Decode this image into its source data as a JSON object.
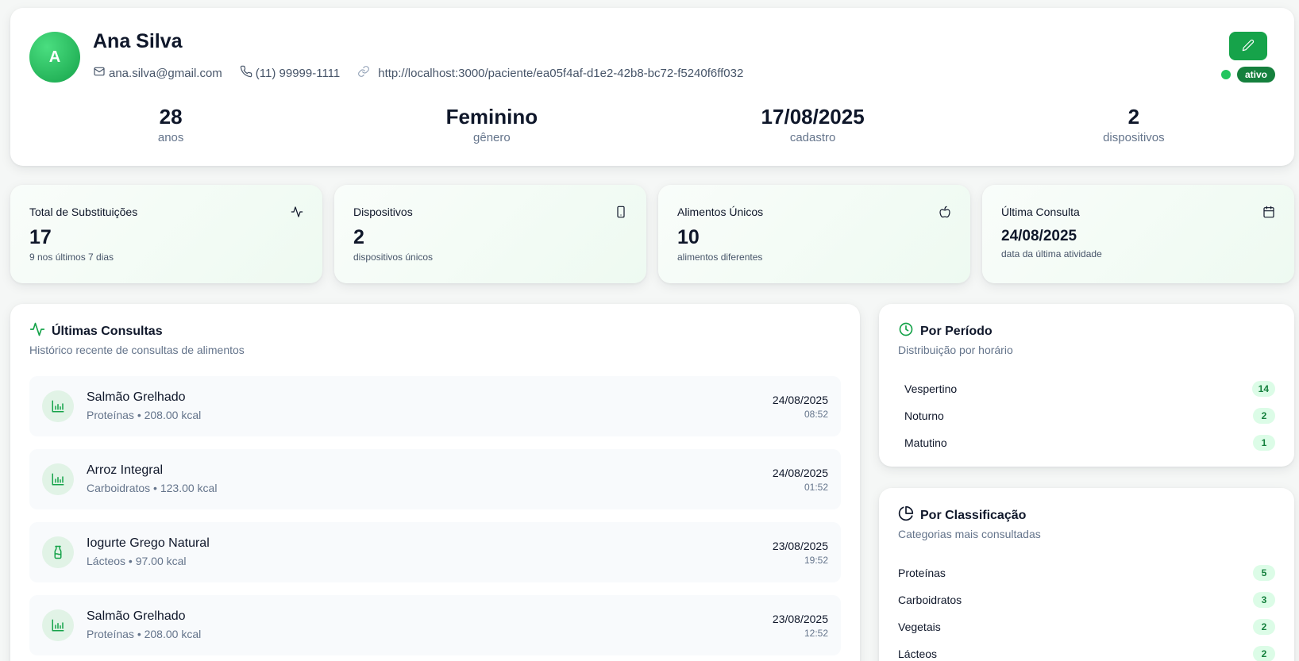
{
  "profile": {
    "avatar_initial": "A",
    "name": "Ana Silva",
    "email": "ana.silva@gmail.com",
    "phone": "(11) 99999-1111",
    "link": "http://localhost:3000/paciente/ea05f4af-d1e2-42b8-bc72-f5240f6ff032",
    "status": "ativo",
    "stats": [
      {
        "value": "28",
        "label": "anos"
      },
      {
        "value": "Feminino",
        "label": "gênero"
      },
      {
        "value": "17/08/2025",
        "label": "cadastro"
      },
      {
        "value": "2",
        "label": "dispositivos"
      }
    ]
  },
  "metrics": [
    {
      "title": "Total de Substituições",
      "icon": "activity-icon",
      "value": "17",
      "sub": "9 nos últimos 7 dias"
    },
    {
      "title": "Dispositivos",
      "icon": "smartphone-icon",
      "value": "2",
      "sub": "dispositivos únicos"
    },
    {
      "title": "Alimentos Únicos",
      "icon": "apple-icon",
      "value": "10",
      "sub": "alimentos diferentes"
    },
    {
      "title": "Última Consulta",
      "icon": "calendar-icon",
      "value": "24/08/2025",
      "sub": "data da última atividade"
    }
  ],
  "consultas": {
    "title": "Últimas Consultas",
    "subtitle": "Histórico recente de consultas de alimentos",
    "items": [
      {
        "name": "Salmão Grelhado",
        "detail": "Proteínas • 208.00 kcal",
        "date": "24/08/2025",
        "time": "08:52",
        "icon": "bar-chart-icon"
      },
      {
        "name": "Arroz Integral",
        "detail": "Carboidratos • 123.00 kcal",
        "date": "24/08/2025",
        "time": "01:52",
        "icon": "bar-chart-icon"
      },
      {
        "name": "Iogurte Grego Natural",
        "detail": "Lácteos • 97.00 kcal",
        "date": "23/08/2025",
        "time": "19:52",
        "icon": "milk-icon"
      },
      {
        "name": "Salmão Grelhado",
        "detail": "Proteínas • 208.00 kcal",
        "date": "23/08/2025",
        "time": "12:52",
        "icon": "bar-chart-icon"
      }
    ]
  },
  "periodo": {
    "title": "Por Período",
    "subtitle": "Distribuição por horário",
    "items": [
      {
        "label": "Vespertino",
        "count": "14"
      },
      {
        "label": "Noturno",
        "count": "2"
      },
      {
        "label": "Matutino",
        "count": "1"
      }
    ]
  },
  "classificacao": {
    "title": "Por Classificação",
    "subtitle": "Categorias mais consultadas",
    "items": [
      {
        "label": "Proteínas",
        "count": "5"
      },
      {
        "label": "Carboidratos",
        "count": "3"
      },
      {
        "label": "Vegetais",
        "count": "2"
      },
      {
        "label": "Lácteos",
        "count": "2"
      }
    ]
  },
  "colors": {
    "accent": "#16a34a",
    "accent_dark": "#15803d",
    "badge_bg": "#dcfce7"
  }
}
